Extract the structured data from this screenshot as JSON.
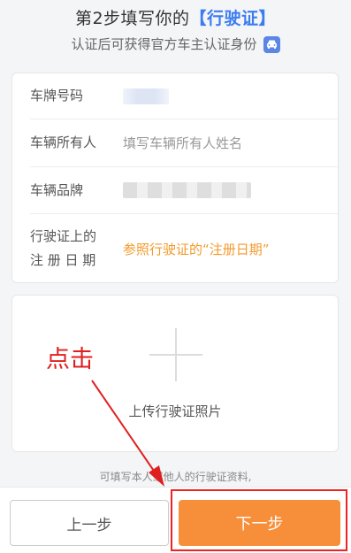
{
  "header": {
    "title_prefix": "第2步填写你的",
    "title_highlight": "【行驶证】",
    "subtitle": "认证后可获得官方车主认证身份",
    "badge_icon": "car-icon"
  },
  "form": {
    "fields": [
      {
        "label": "车牌号码",
        "value": ""
      },
      {
        "label": "车辆所有人",
        "placeholder": "填写车辆所有人姓名"
      },
      {
        "label": "车辆品牌",
        "value": ""
      },
      {
        "label_line1": "行驶证上的",
        "label_line2": "注 册 日 期",
        "hint": "参照行驶证的“注册日期”"
      }
    ]
  },
  "upload": {
    "icon": "plus-icon",
    "label": "上传行驶证照片"
  },
  "note": "可填写本人或他人的行驶证资料,",
  "buttons": {
    "prev": "上一步",
    "next": "下一步"
  },
  "annotation": {
    "text": "点击",
    "color": "#e02020"
  },
  "colors": {
    "accent": "#3b7cf2",
    "orange": "#f78f3a",
    "annotation_red": "#f02222"
  }
}
